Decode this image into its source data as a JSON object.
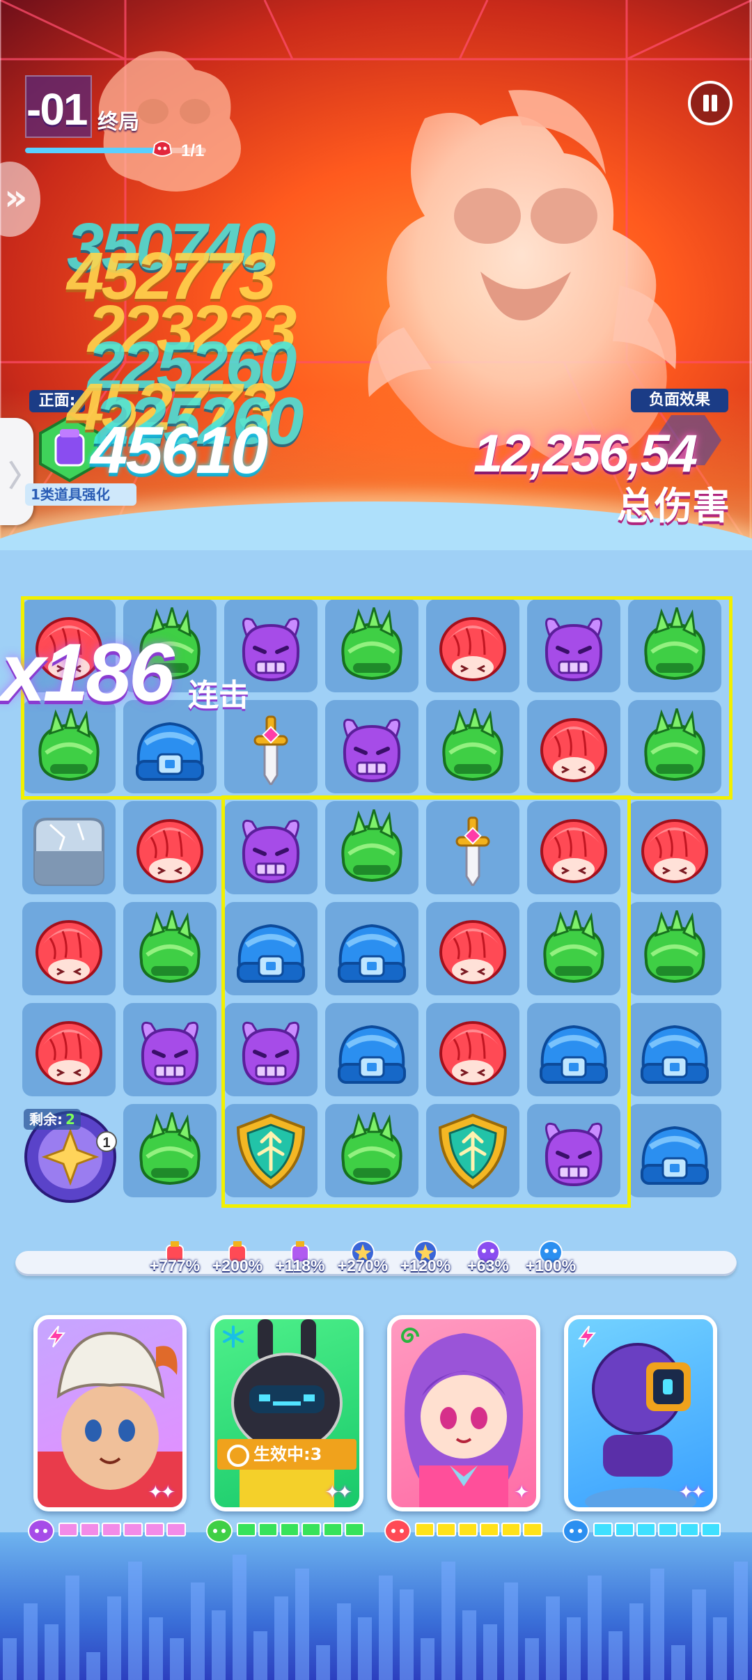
{
  "stage": {
    "number": "-01",
    "label": "终局",
    "wave": "1/1"
  },
  "buffs_panel": {
    "positive_title": "正面:",
    "positive_item_label": "1类道具强化",
    "negative_title": "负面效果"
  },
  "damage": {
    "popups_cyan": [
      "350740",
      "225260",
      "225260"
    ],
    "popups_yellow": [
      "452773",
      "223223",
      "452773"
    ],
    "main_popup": "45610"
  },
  "total_damage": {
    "value": "12,256,54",
    "label": "总伤害"
  },
  "combo": {
    "count": "x186",
    "label": "连击"
  },
  "board": {
    "rows": [
      [
        "red",
        "green",
        "purple",
        "green",
        "red",
        "purple",
        "green"
      ],
      [
        "green",
        "blue",
        "sword",
        "purple",
        "green",
        "red",
        "green"
      ],
      [
        "ice",
        "red",
        "purple",
        "green",
        "sword",
        "red",
        "red"
      ],
      [
        "red",
        "green",
        "blue",
        "blue",
        "red",
        "green",
        "green"
      ],
      [
        "red",
        "purple",
        "purple",
        "blue",
        "red",
        "blue",
        "blue"
      ],
      [
        "skill",
        "green",
        "shield",
        "green",
        "shield",
        "purple",
        "blue"
      ]
    ]
  },
  "skill": {
    "remaining_label": "剩余:",
    "remaining_value": "2",
    "badge": "1"
  },
  "buff_strip": [
    {
      "icon": "red-potion-icon",
      "value": "+777%"
    },
    {
      "icon": "red-potion-icon",
      "value": "+200%"
    },
    {
      "icon": "purple-potion-icon",
      "value": "+118%"
    },
    {
      "icon": "blue-star-icon",
      "value": "+270%"
    },
    {
      "icon": "blue-star-icon",
      "value": "+120%"
    },
    {
      "icon": "purple-critter-icon",
      "value": "+63%"
    },
    {
      "icon": "blue-critter-icon",
      "value": "+100%"
    }
  ],
  "heroes": [
    {
      "name": "skull-warrior",
      "element": "purple",
      "type_icon": "lightning-icon",
      "energy_filled": 6,
      "energy_total": 6,
      "energy_color": "#f28be8"
    },
    {
      "name": "bunny-robot",
      "element": "green",
      "type_icon": "snowflake-icon",
      "effect": "生效中:3",
      "energy_filled": 6,
      "energy_total": 6,
      "energy_color": "#37e25a"
    },
    {
      "name": "maid-girl",
      "element": "red",
      "type_icon": "swirl-icon",
      "energy_filled": 6,
      "energy_total": 6,
      "energy_color": "#ffe21a"
    },
    {
      "name": "purple-robot",
      "element": "blue",
      "type_icon": "lightning-icon",
      "energy_filled": 6,
      "energy_total": 6,
      "energy_color": "#3fe0ff"
    }
  ],
  "colors": {
    "selection": "#f2f000",
    "board_cell": "#6fa8de",
    "accent_purple": "#8a3bd1"
  }
}
